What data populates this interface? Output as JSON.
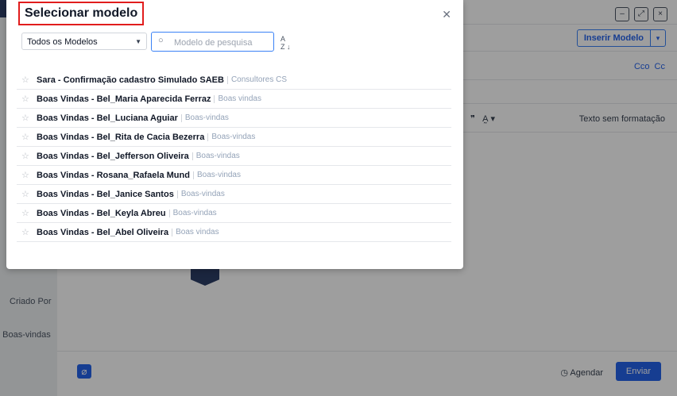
{
  "background": {
    "left_labels": [
      "Criado Por",
      "o Boas-vindas"
    ],
    "window_buttons": [
      "minimize-icon",
      "expand-icon",
      "close-icon"
    ],
    "insert_button": "Inserir Modelo",
    "cco_cc": "Cco  Cc",
    "plain_text": "Texto sem formatação",
    "schedule": "Agendar",
    "send": "Enviar"
  },
  "modal": {
    "title": "Selecionar modelo",
    "filter_value": "Todos os Modelos",
    "search_placeholder": "Modelo de pesquisa",
    "sort_label": "A Z",
    "items": [
      {
        "name": "Sara - Confirmação cadastro Simulado SAEB",
        "category": "Consultores CS"
      },
      {
        "name": "Boas Vindas - Bel_Maria Aparecida Ferraz",
        "category": "Boas vindas"
      },
      {
        "name": "Boas Vindas - Bel_Luciana Aguiar",
        "category": "Boas-vindas"
      },
      {
        "name": "Boas Vindas - Bel_Rita de Cacia Bezerra",
        "category": "Boas-vindas"
      },
      {
        "name": "Boas Vindas - Bel_Jefferson Oliveira",
        "category": "Boas-vindas"
      },
      {
        "name": "Boas Vindas - Rosana_Rafaela Mund",
        "category": "Boas-vindas"
      },
      {
        "name": "Boas Vindas - Bel_Janice Santos",
        "category": "Boas-vindas"
      },
      {
        "name": "Boas Vindas - Bel_Keyla Abreu",
        "category": "Boas-vindas"
      },
      {
        "name": "Boas Vindas - Bel_Abel Oliveira",
        "category": "Boas vindas"
      }
    ]
  },
  "colors": {
    "accent": "#2563eb",
    "highlight": "#e11d1d"
  }
}
